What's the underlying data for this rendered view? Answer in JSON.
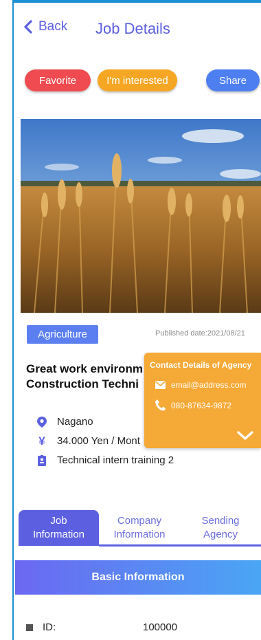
{
  "header": {
    "back_label": "Back",
    "title": "Job Details"
  },
  "actions": {
    "favorite": "Favorite",
    "interested": "I'm interested",
    "share": "Share"
  },
  "job": {
    "category": "Agriculture",
    "published": "Published date:2021/08/21",
    "title_line1": "Great work environm",
    "title_line2": "Construction Techni",
    "location": "Nagano",
    "salary": "34.000 Yen / Mont",
    "program": "Technical intern training 2"
  },
  "contact": {
    "title": "Contact Details of Agency",
    "email": "email@address.com",
    "phone": "080-87634-9872"
  },
  "tabs": [
    {
      "line1": "Job",
      "line2": "Information"
    },
    {
      "line1": "Company",
      "line2": "Information"
    },
    {
      "line1": "Sending",
      "line2": "Agency"
    }
  ],
  "section": {
    "title": "Basic Information"
  },
  "fields": [
    {
      "label": "ID:",
      "value": "100000"
    }
  ],
  "colors": {
    "accent": "#5b5fe0",
    "favorite": "#ef4b50",
    "interested": "#f5a623",
    "share": "#4d7ff0",
    "contact": "#f5a936"
  }
}
